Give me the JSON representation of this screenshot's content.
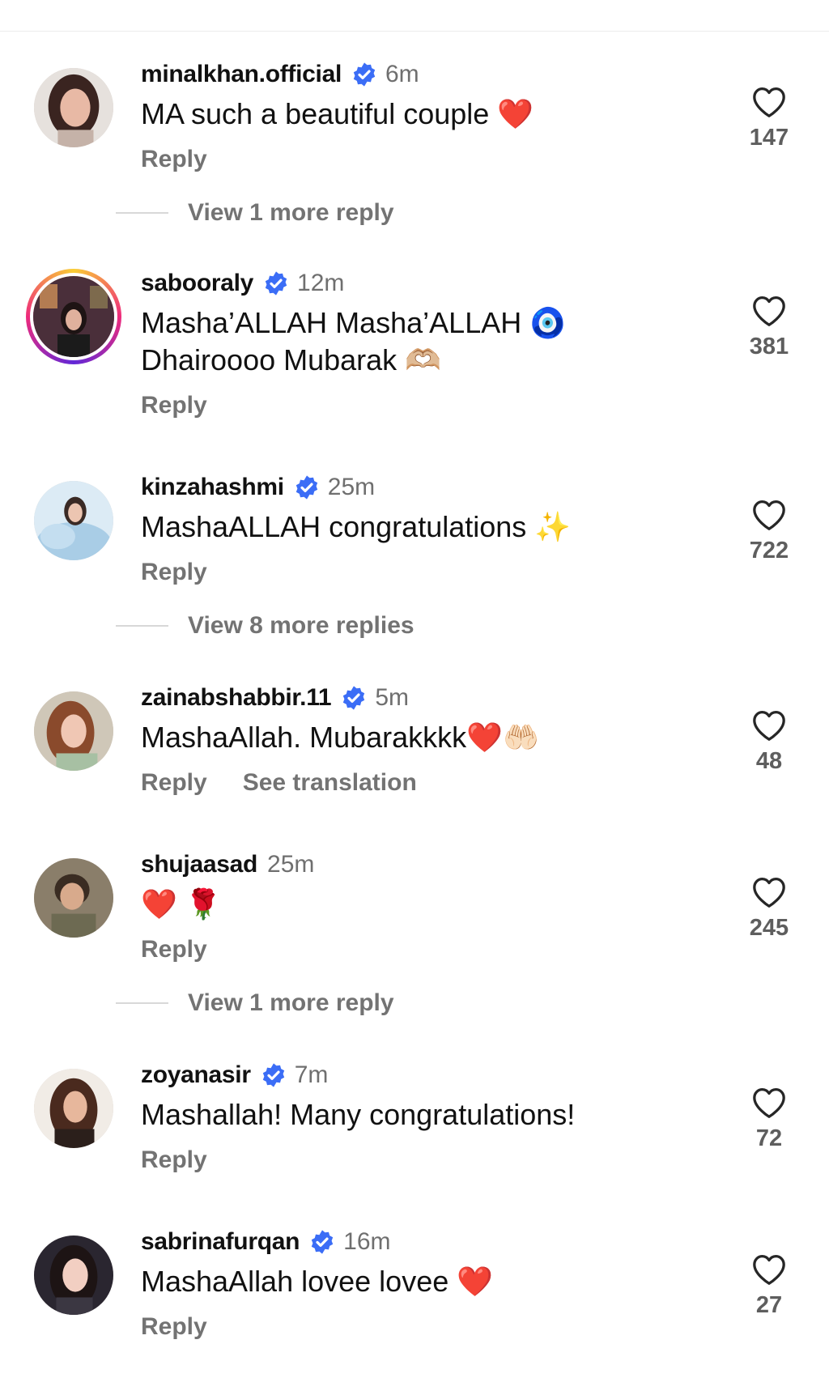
{
  "icons": {
    "verified": "verified-badge-icon",
    "like": "heart-outline-icon"
  },
  "colors": {
    "verified": "#3b6df6",
    "heart_red": "#e0245e",
    "muted": "#737373"
  },
  "comments": [
    {
      "username": "minalkhan.official",
      "verified": true,
      "time": "6m",
      "lines": [
        "MA such a beautiful couple ❤️"
      ],
      "reply": "Reply",
      "likes": "147",
      "view_more": "View 1 more reply"
    },
    {
      "username": "sabooraly",
      "verified": true,
      "time": "12m",
      "lines": [
        "Masha’ALLAH Masha’ALLAH 🧿",
        "Dhairoooo Mubarak 🫶🏼"
      ],
      "reply": "Reply",
      "likes": "381"
    },
    {
      "username": "kinzahashmi",
      "verified": true,
      "time": "25m",
      "lines": [
        "MashaALLAH congratulations ✨"
      ],
      "reply": "Reply",
      "likes": "722",
      "view_more": "View 8 more replies"
    },
    {
      "username": "zainabshabbir.11",
      "verified": true,
      "time": "5m",
      "lines": [
        "MashaAllah. Mubarakkkk❤️🤲🏻"
      ],
      "reply": "Reply",
      "translate": "See translation",
      "likes": "48"
    },
    {
      "username": "shujaasad",
      "verified": false,
      "time": "25m",
      "lines": [
        "❤️ 🌹"
      ],
      "reply": "Reply",
      "likes": "245",
      "view_more": "View 1 more reply"
    },
    {
      "username": "zoyanasir",
      "verified": true,
      "time": "7m",
      "lines": [
        "Mashallah! Many congratulations!"
      ],
      "reply": "Reply",
      "likes": "72"
    },
    {
      "username": "sabrinafurqan",
      "verified": true,
      "time": "16m",
      "lines": [
        "MashaAllah lovee lovee ❤️"
      ],
      "reply": "Reply",
      "likes": "27"
    }
  ]
}
